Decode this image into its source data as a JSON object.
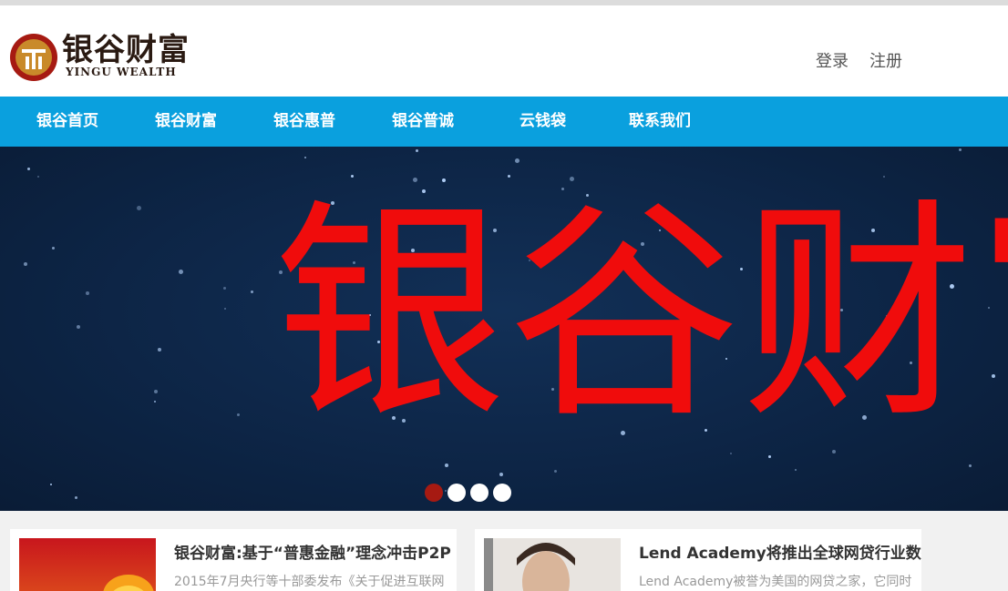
{
  "header": {
    "logo_cn": "银谷财富",
    "logo_en": "YINGU WEALTH",
    "login_label": "登录",
    "register_label": "注册"
  },
  "nav": {
    "items": [
      {
        "label": "银谷首页"
      },
      {
        "label": "银谷财富"
      },
      {
        "label": "银谷惠普"
      },
      {
        "label": "银谷普诚"
      },
      {
        "label": "云钱袋"
      },
      {
        "label": "联系我们"
      }
    ]
  },
  "banner": {
    "title": "银谷财富",
    "slide_count": 4,
    "active_slide": 1
  },
  "articles": [
    {
      "title": "银谷财富:基于“普惠金融”理念冲击P2P",
      "excerpt": "2015年7月央行等十部委发布《关于促进互联网"
    },
    {
      "title": "Lend Academy将推出全球网贷行业数据",
      "excerpt": "Lend Academy被誉为美国的网贷之家，它同时"
    }
  ],
  "colors": {
    "nav_bg": "#0aa0de",
    "banner_text": "#f00c0c",
    "brand_red": "#a61a12"
  }
}
